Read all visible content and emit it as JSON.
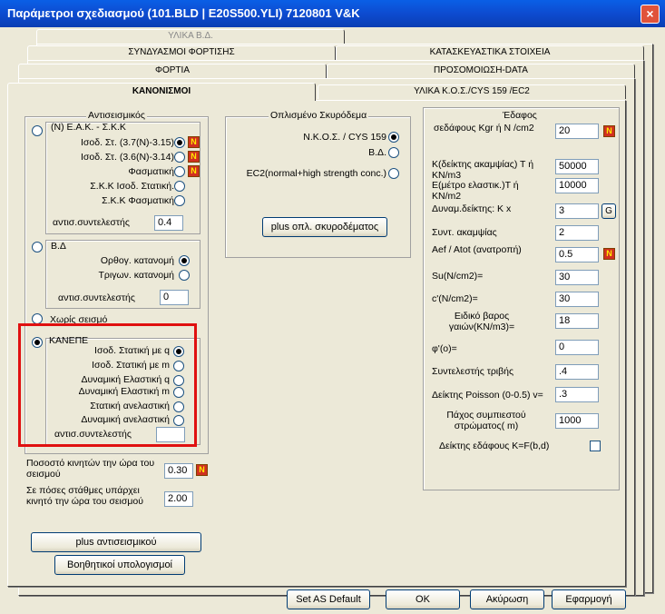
{
  "window": {
    "title": "Παράμετροι σχεδιασμού (101.BLD | E20S500.YLI) 7120801  V&K",
    "close_glyph": "×"
  },
  "tabs": {
    "row1": [
      "ΥΛΙΚΑ Β.Δ."
    ],
    "row2": [
      "ΣΥΝΔΥΑΣΜΟΙ ΦΟΡΤΙΣΗΣ",
      "ΚΑΤΑΣΚΕΥΑΣΤΙΚΑ ΣΤΟΙΧΕΙΑ"
    ],
    "row3": [
      "ΦΟΡΤΙΑ",
      "ΠΡΟΣΟΜΟΙΩΣΗ-DATA"
    ],
    "row4": [
      "ΚΑΝΟΝΙΣΜΟΙ",
      "ΥΛΙΚΑ Κ.Ο.Σ./CYS 159 /EC2"
    ]
  },
  "seismic": {
    "title": "Αντισεισμικός",
    "eak_label": "(Ν) Ε.Α.Κ. - Σ.Κ.Κ",
    "eak_opts": [
      "Ισοδ. Στ. (3.7(Ν)-3.15)",
      "Ισοδ. Στ. (3.6(Ν)-3.14)",
      "Φασματική",
      "Σ.Κ.Κ Ισοδ. Στατική.",
      "Σ.Κ.Κ Φασματική"
    ],
    "coef_label": "αντισ.συντελεστής",
    "eak_coef": "0.4",
    "bd_label": "Β.Δ",
    "bd_opts": [
      "Ορθογ. κατανομή",
      "Τριγων. κατανομή"
    ],
    "bd_coef": "0",
    "no_seismic": "Χωρίς σεισμό",
    "kanepe_label": "ΚΑΝΕΠΕ",
    "kanepe_opts": [
      "Ισοδ. Στατική με    q",
      "Ισοδ. Στατική με    m",
      "Δυναμική Ελαστική q",
      "Δυναμική Ελαστική m",
      "Στατική ανελαστική",
      "Δυναμική ανελαστική"
    ],
    "kanepe_coef": "",
    "moving_pct_label": "Ποσοστό κινητών την ώρα του σεισμού",
    "moving_pct": "0.30",
    "floors_label": "Σε πόσες στάθμες υπάρχει κινητό την ώρα του σεισμού",
    "floors": "2.00",
    "plus_seismic_btn": "plus αντισεισμικού",
    "aux_calc_btn": "Βοηθητικοί υπολογισμοί"
  },
  "concrete": {
    "title": "Οπλισμένο Σκυρόδεμα",
    "opts": [
      "Ν.Κ.Ο.Σ. / CYS 159",
      "Β.Δ.",
      "EC2(normal+high strength conc.)"
    ],
    "plus_btn": "plus οπλ. σκυροδέματος"
  },
  "soil": {
    "title": "Έδαφος",
    "fields": [
      {
        "label": "σεδάφους Kgr ή N /cm2",
        "value": "20",
        "extra": "N"
      },
      {
        "label": "Κ(δείκτης ακαμψίας) Τ ή KN/m3",
        "value": "50000"
      },
      {
        "label": "Ε(μέτρο ελαστικ.)Τ ή KN/m2",
        "value": "10000"
      },
      {
        "label": "Δυναμ.δείκτης: K x",
        "value": "3",
        "extra": "G"
      },
      {
        "label": "Συντ. ακαμψίας",
        "value": "2"
      },
      {
        "label": "Aef / Atot (ανατροπή)",
        "value": "0.5",
        "extra": "N"
      },
      {
        "label": "Su(N/cm2)=",
        "value": "30"
      },
      {
        "label": "c'(N/cm2)=",
        "value": "30"
      },
      {
        "label": "Ειδικό βαρος γαιών(KN/m3)=",
        "value": "18"
      },
      {
        "label": "φ'(ο)=",
        "value": "0"
      },
      {
        "label": "Συντελεστής τριβής",
        "value": ".4"
      },
      {
        "label": "Δείκτης Poisson (0-0.5) v=",
        "value": ".3"
      },
      {
        "label": "Πάχος συμπιεστού στρώματος( m)",
        "value": "1000"
      }
    ],
    "kfbd_label": "Δείκτης εδάφους K=F(b,d)"
  },
  "footer": {
    "set_default": "Set AS Default",
    "ok": "OK",
    "cancel": "Ακύρωση",
    "apply": "Εφαρμογή"
  },
  "icons": {
    "n_button": "N",
    "g_button": "G"
  }
}
